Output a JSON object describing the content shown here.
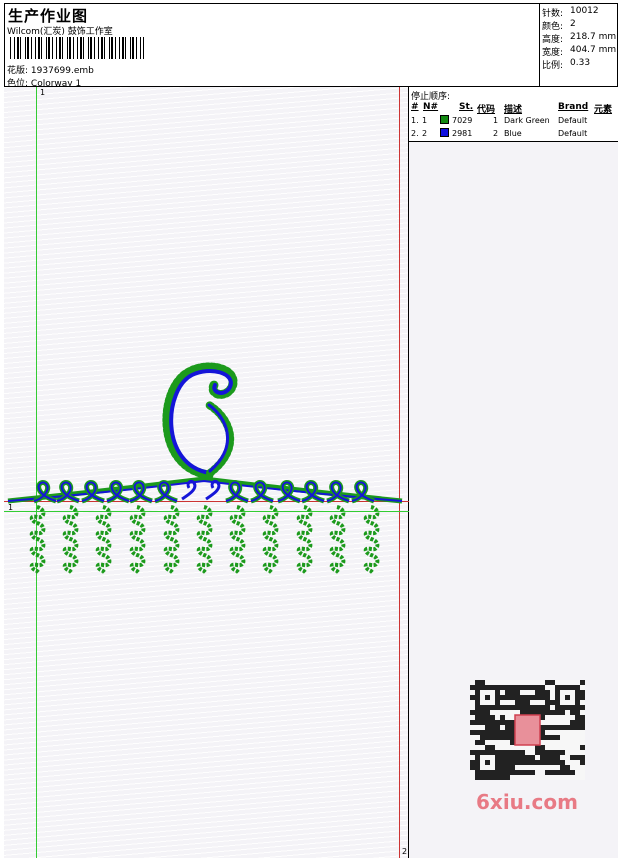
{
  "header": {
    "title": "生产作业图",
    "company": "Wilcom(汇炭) 鼓饰工作室",
    "design_label": "花版:",
    "design_value": "1937699.emb",
    "colorway_label": "色位:",
    "colorway_value": "Colorway 1"
  },
  "stats": [
    {
      "label": "针数:",
      "value": "10012"
    },
    {
      "label": "颜色:",
      "value": "2"
    },
    {
      "label": "高度:",
      "value": "218.7 mm"
    },
    {
      "label": "宽度:",
      "value": "404.7 mm"
    },
    {
      "label": "比例:",
      "value": "0.33"
    }
  ],
  "stop_sequence": {
    "title": "停止顺序:",
    "columns": [
      "#",
      "N#",
      "St.",
      "代码",
      "描述",
      "Brand",
      "元素"
    ],
    "rows": [
      {
        "num": "1.",
        "needle": "1",
        "color": "#138a13",
        "st": "7029",
        "code": "1",
        "desc": "Dark Green",
        "brand": "Default"
      },
      {
        "num": "2.",
        "needle": "2",
        "color": "#1010e0",
        "st": "2981",
        "code": "2",
        "desc": "Blue",
        "brand": "Default"
      }
    ]
  },
  "markers": {
    "top_left": "1",
    "left_axis": "1",
    "bottom_right": "2"
  },
  "colors": {
    "green": "#1c9a1c",
    "blue": "#1515d8",
    "guide_green": "#33cc33",
    "guide_red": "#cc3333"
  },
  "watermark": "6xiu.com"
}
